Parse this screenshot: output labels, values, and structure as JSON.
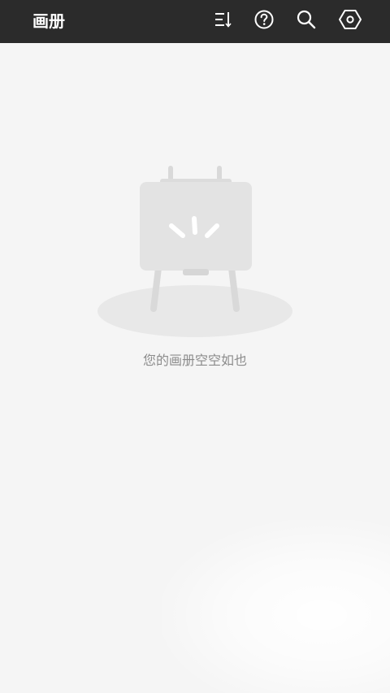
{
  "header": {
    "title": "画册",
    "background_color": "#2b2b2b",
    "icons": [
      "sort-icon",
      "help-icon",
      "search-icon",
      "settings-icon"
    ]
  },
  "main": {
    "background_color": "#f5f5f5",
    "empty_state": {
      "illustration": "easel-icon",
      "message": "您的画册空空如也"
    }
  }
}
